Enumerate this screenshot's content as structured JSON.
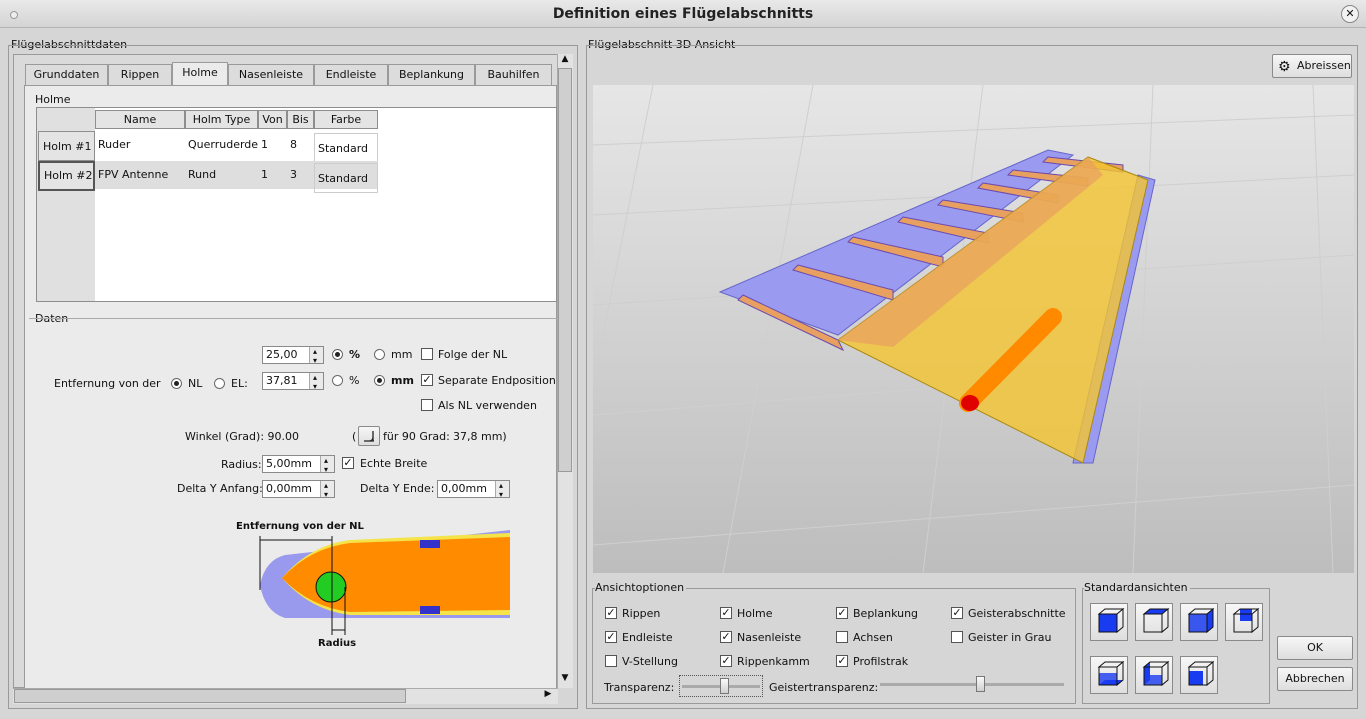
{
  "window": {
    "title": "Definition eines Flügelabschnitts"
  },
  "left": {
    "group_title": "Flügelabschnittdaten",
    "tabs": [
      "Grunddaten",
      "Rippen",
      "Holme",
      "Nasenleiste",
      "Endleiste",
      "Beplankung",
      "Bauhilfen"
    ],
    "active_tab": "Holme",
    "holme": {
      "title": "Holme",
      "columns": [
        "Name",
        "Holm Type",
        "Von",
        "Bis",
        "Farbe"
      ],
      "rows": [
        {
          "header": "Holm #1",
          "name": "Ruder",
          "type": "Querruderde",
          "von": "1",
          "bis": "8",
          "farbe": "Standard"
        },
        {
          "header": "Holm #2",
          "name": "FPV Antenne",
          "type": "Rund",
          "von": "1",
          "bis": "3",
          "farbe": "Standard"
        }
      ]
    },
    "daten": {
      "title": "Daten",
      "entfernung_label": "Entfernung von der",
      "nl_label": "NL",
      "el_label": "EL:",
      "value1": "25,00",
      "value2": "37,81",
      "pct": "%",
      "mm": "mm",
      "folge_nl": "Folge der NL",
      "separate_endposition": "Separate Endposition",
      "als_nl": "Als NL verwenden",
      "winkel_label": "Winkel (Grad): 90.00",
      "paren": "(",
      "fuer90": "für 90 Grad:",
      "fuer90_value": "37,8 mm)",
      "radius_label": "Radius:",
      "radius_value": "5,00mm",
      "echte_breite": "Echte Breite",
      "delta_anfang_label": "Delta Y Anfang:",
      "delta_anfang_value": "0,00mm",
      "delta_ende_label": "Delta Y Ende:",
      "delta_ende_value": "0,00mm",
      "diagram_top_label": "Entfernung von der NL",
      "diagram_bottom_label": "Radius"
    }
  },
  "right": {
    "group_title": "Flügelabschnitt 3D Ansicht",
    "abreissen": "Abreissen",
    "ansicht": {
      "title": "Ansichtoptionen",
      "options": [
        {
          "label": "Rippen",
          "checked": true
        },
        {
          "label": "Holme",
          "checked": true
        },
        {
          "label": "Beplankung",
          "checked": true
        },
        {
          "label": "Geisterabschnitte",
          "checked": true
        },
        {
          "label": "Endleiste",
          "checked": true
        },
        {
          "label": "Nasenleiste",
          "checked": true
        },
        {
          "label": "Achsen",
          "checked": false
        },
        {
          "label": "Geister in Grau",
          "checked": false
        },
        {
          "label": "V-Stellung",
          "checked": false
        },
        {
          "label": "Rippenkamm",
          "checked": true
        },
        {
          "label": "Profilstrak",
          "checked": true
        }
      ],
      "transparenz_label": "Transparenz:",
      "transparenz_value": 0.55,
      "geister_label": "Geistertransparenz:",
      "geister_value": 0.55
    },
    "standard": {
      "title": "Standardansichten"
    },
    "ok": "OK",
    "abbrechen": "Abbrechen"
  }
}
